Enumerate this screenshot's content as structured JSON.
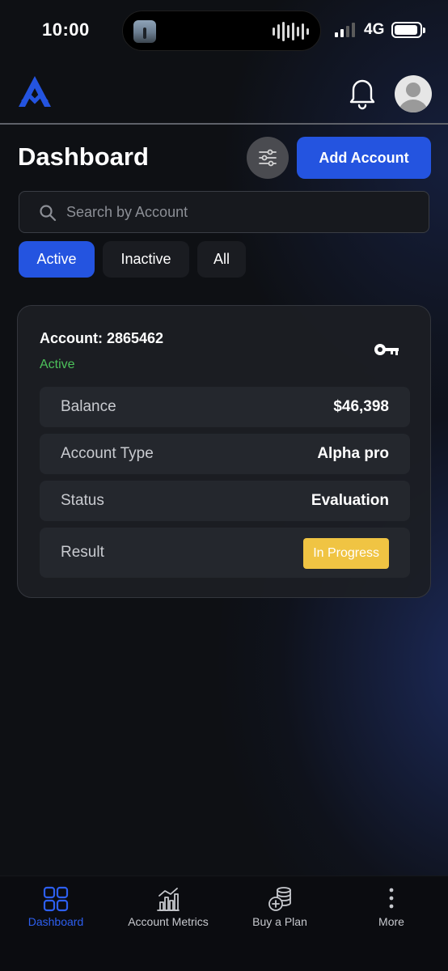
{
  "status_bar": {
    "time": "10:00",
    "network": "4G"
  },
  "header": {
    "logo_icon": "brand-logo-icon",
    "notification_icon": "bell-icon",
    "avatar_icon": "user-avatar-icon"
  },
  "page": {
    "title": "Dashboard",
    "add_account_label": "Add Account",
    "filter_icon": "sliders-icon"
  },
  "search": {
    "placeholder": "Search by Account",
    "value": ""
  },
  "tabs": [
    {
      "label": "Active",
      "selected": true
    },
    {
      "label": "Inactive",
      "selected": false
    },
    {
      "label": "All",
      "selected": false
    }
  ],
  "account_card": {
    "title": "Account: 2865462",
    "status": "Active",
    "status_color": "#4cc15a",
    "rows": [
      {
        "label": "Balance",
        "value": "$46,398"
      },
      {
        "label": "Account Type",
        "value": "Alpha pro"
      },
      {
        "label": "Status",
        "value": "Evaluation"
      },
      {
        "label": "Result",
        "value": "In Progress"
      }
    ]
  },
  "bottom_nav": [
    {
      "label": "Dashboard",
      "icon": "grid-icon",
      "active": true
    },
    {
      "label": "Account Metrics",
      "icon": "chart-icon",
      "active": false
    },
    {
      "label": "Buy a Plan",
      "icon": "coins-plus-icon",
      "active": false
    },
    {
      "label": "More",
      "icon": "more-vertical-icon",
      "active": false
    }
  ],
  "colors": {
    "accent": "#2454e0",
    "badge": "#f0c443",
    "background": "#0e1014"
  }
}
